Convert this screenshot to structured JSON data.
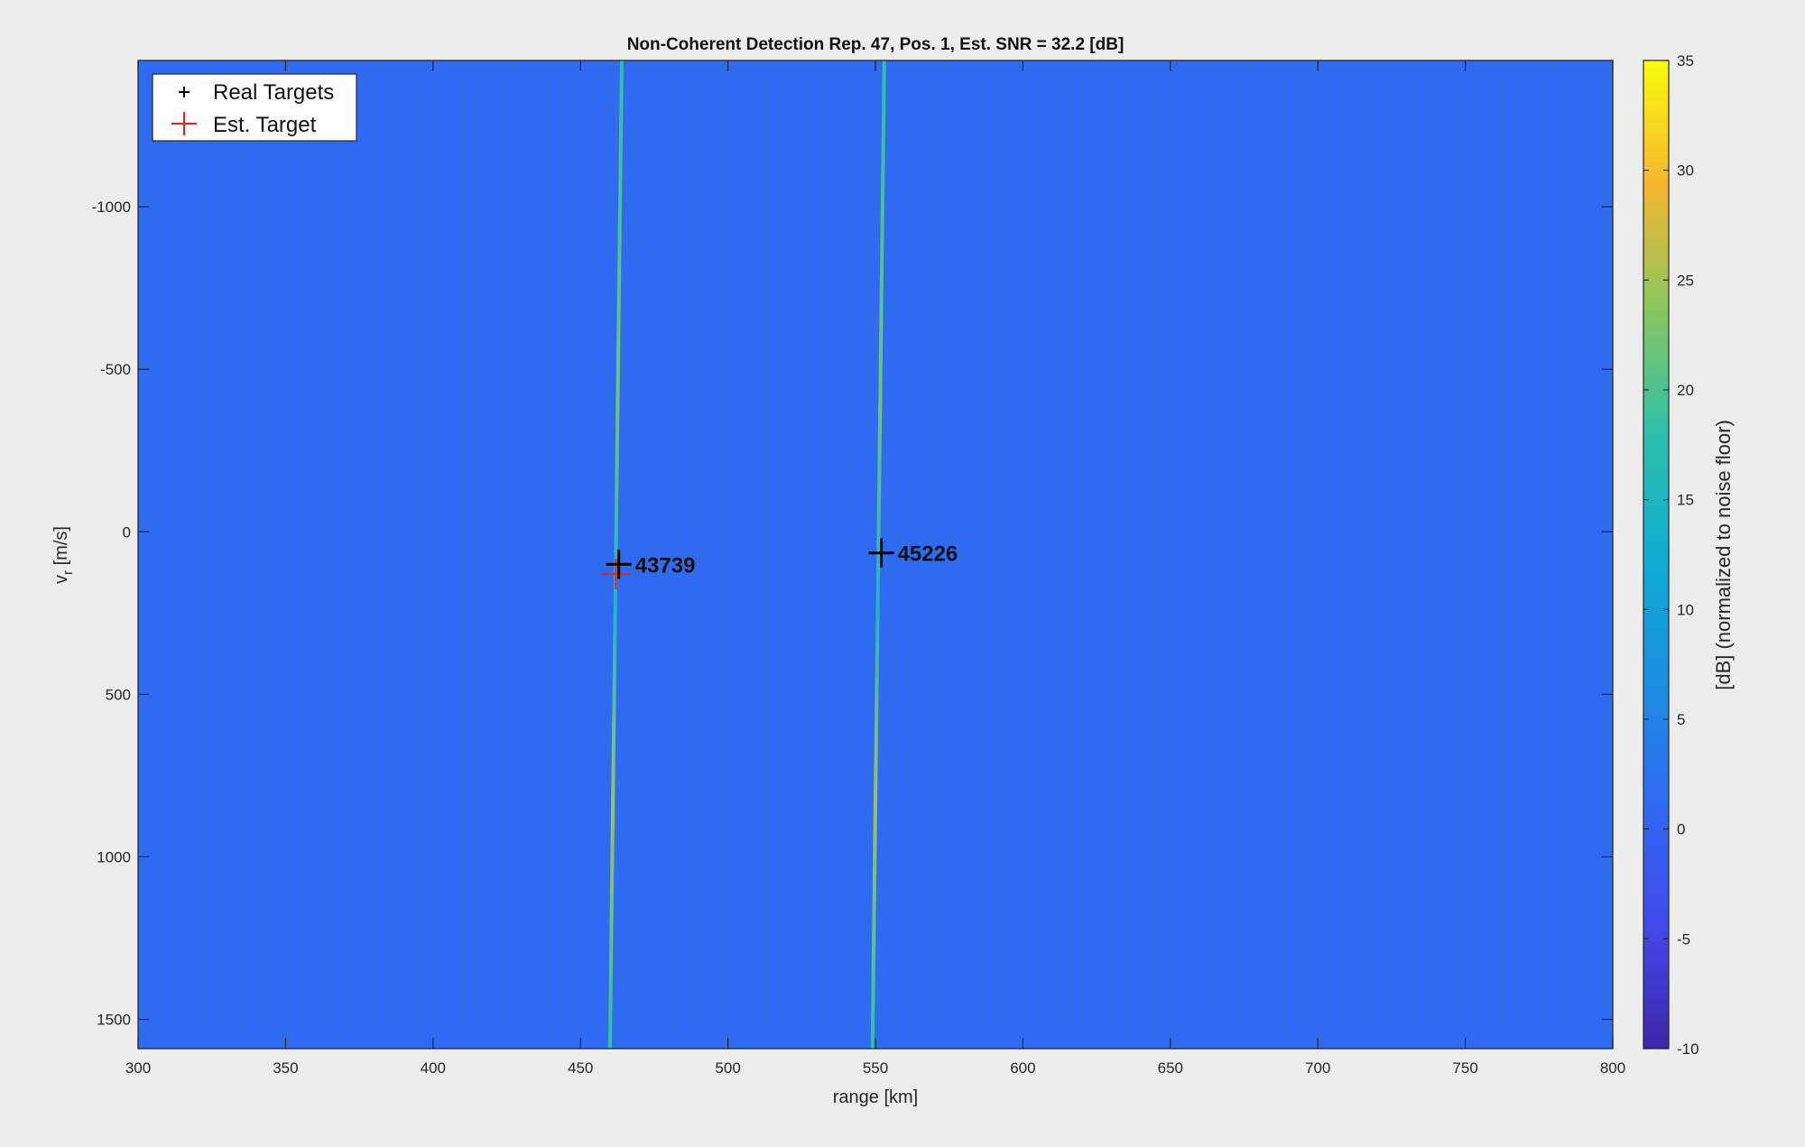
{
  "chart_data": {
    "type": "heatmap",
    "title": "Non-Coherent Detection Rep. 47, Pos. 1, Est. SNR = 32.2 [dB]",
    "xlabel": "range [km]",
    "ylabel_main": "v",
    "ylabel_sub": "r",
    "ylabel_unit": " [m/s]",
    "xlim": [
      300,
      800
    ],
    "ylim": [
      -1450,
      1590
    ],
    "y_direction": "reversed",
    "xticks": [
      300,
      350,
      400,
      450,
      500,
      550,
      600,
      650,
      700,
      750,
      800
    ],
    "yticks": [
      -1000,
      -500,
      0,
      500,
      1000,
      1500
    ],
    "grid": false,
    "background_level_db": 0,
    "colorbar": {
      "label": "[dB] (normalized to noise floor)",
      "range": [
        -10,
        35
      ],
      "ticks": [
        -10,
        -5,
        0,
        5,
        10,
        15,
        20,
        25,
        30,
        35
      ],
      "colormap": "parula"
    },
    "ridges": [
      {
        "x_top": 464,
        "x_bottom": 460,
        "level_db": 15
      },
      {
        "x_top": 553,
        "x_bottom": 549,
        "level_db": 15
      }
    ],
    "real_targets": [
      {
        "range": 463,
        "velocity": 100,
        "label": "43739"
      },
      {
        "range": 552,
        "velocity": 65,
        "label": "45226"
      }
    ],
    "est_target": {
      "range": 462,
      "velocity": 130
    },
    "legend": {
      "position": "top-left",
      "entries": [
        "Real Targets",
        "Est. Target"
      ]
    },
    "colors": {
      "background_field": "#2f6bf2",
      "ridge": "#2fc0a8",
      "real_marker": "#000000",
      "est_marker": "#e8202a"
    }
  }
}
